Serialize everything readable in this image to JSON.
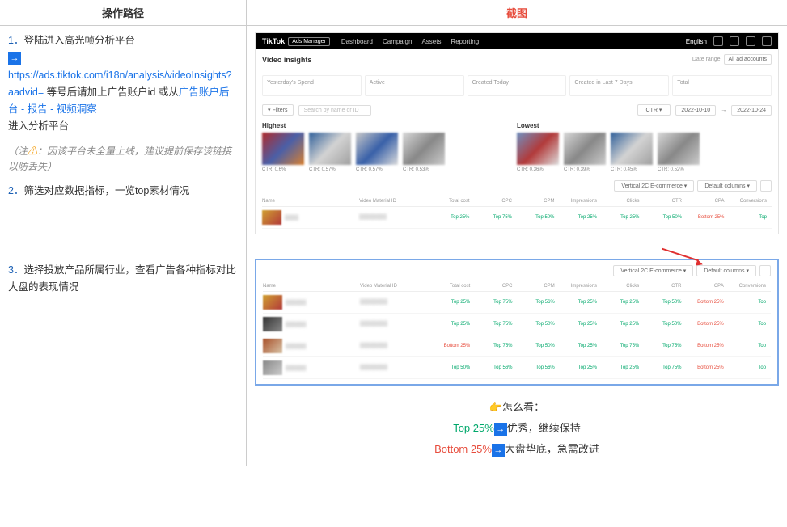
{
  "headers": {
    "left": "操作路径",
    "right": "截图"
  },
  "step1": {
    "num": "1．",
    "text_a": "登陆进入高光帧分析平台",
    "url": "https://ads.tiktok.com/i18n/analysis/videoInsights?aadvid=",
    "text_b": " 等号后请加上广告账户id 或从",
    "path_link": "广告账户后台 - 报告 - 视频洞察",
    "text_c": "进入分析平台"
  },
  "note": {
    "open": "（注",
    "warn": "⚠",
    "body": "：因该平台未全量上线，建议提前保存该链接以防丢失）"
  },
  "step2": {
    "num": "2．",
    "text": "筛选对应数据指标，一览top素材情况"
  },
  "step3": {
    "num": "3．",
    "text": "选择投放产品所属行业，查看广告各种指标对比大盘的表现情况"
  },
  "tiktok": {
    "brand": "TikTok",
    "mgr": "Ads Manager",
    "nav": [
      "Dashboard",
      "Campaign",
      "Assets",
      "Reporting"
    ],
    "english": "English"
  },
  "insights": {
    "title": "Video insights",
    "date_label": "Date range",
    "account_sel": "All ad accounts"
  },
  "metrics": [
    "Yesterday's Spend",
    "Active",
    "Created Today",
    "Created in Last 7 Days",
    "Total"
  ],
  "filter": {
    "filters": "Filters",
    "search_ph": "Search by name or ID",
    "ctr": "CTR",
    "date_from": "2022-10-10",
    "date_to": "2022-10-24"
  },
  "hl": {
    "high": "Highest",
    "low": "Lowest",
    "high_vals": [
      "CTR: 0.6%",
      "CTR: 0.57%",
      "CTR: 0.57%",
      "CTR: 0.53%"
    ],
    "low_vals": [
      "CTR: 0.36%",
      "CTR: 0.39%",
      "CTR: 0.45%",
      "CTR: 0.52%"
    ]
  },
  "table_ctrl": {
    "vertical": "Vertical 2C E-commerce",
    "columns": "Default columns"
  },
  "cols": [
    "Name",
    "Video Material ID",
    "Total cost",
    "CPC",
    "CPM",
    "Impressions",
    "Clicks",
    "CTR",
    "CPA",
    "Conversions"
  ],
  "table1_rows": [
    {
      "vals": [
        "Top 25%",
        "Top 75%",
        "Top 50%",
        "Top 25%",
        "Top 25%",
        "Top 50%",
        "Bottom 25%",
        "Top"
      ]
    }
  ],
  "table2_rows": [
    {
      "vals": [
        "Top 25%",
        "Top 75%",
        "Top 56%",
        "Top 25%",
        "Top 25%",
        "Top 50%",
        "Bottom 25%",
        "Top"
      ]
    },
    {
      "vals": [
        "Top 25%",
        "Top 75%",
        "Top 50%",
        "Top 25%",
        "Top 25%",
        "Top 50%",
        "Bottom 25%",
        "Top"
      ]
    },
    {
      "vals": [
        "Bottom 25%",
        "Top 75%",
        "Top 50%",
        "Top 25%",
        "Top 75%",
        "Top 75%",
        "Bottom 25%",
        "Top"
      ]
    },
    {
      "vals": [
        "Top 50%",
        "Top 56%",
        "Top 56%",
        "Top 25%",
        "Top 25%",
        "Top 75%",
        "Bottom 25%",
        "Top"
      ]
    }
  ],
  "legend": {
    "title": "怎么看：",
    "l1a": "Top 25%",
    "l1b": "优秀，继续保持",
    "l2a": "Bottom 25%",
    "l2b": "大盘垫底，急需改进"
  }
}
